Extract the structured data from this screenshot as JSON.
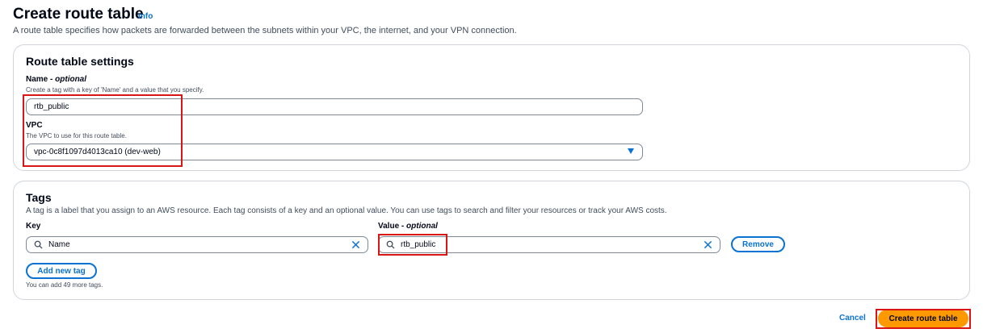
{
  "header": {
    "title": "Create route table",
    "info": "Info",
    "description": "A route table specifies how packets are forwarded between the subnets within your VPC, the internet, and your VPN connection."
  },
  "settings": {
    "title": "Route table settings",
    "name_label": "Name",
    "name_optional": "optional",
    "name_desc": "Create a tag with a key of 'Name' and a value that you specify.",
    "name_value": "rtb_public",
    "vpc_label": "VPC",
    "vpc_desc": "The VPC to use for this route table.",
    "vpc_value": "vpc-0c8f1097d4013ca10 (dev-web)"
  },
  "tags": {
    "title": "Tags",
    "description": "A tag is a label that you assign to an AWS resource. Each tag consists of a key and an optional value. You can use tags to search and filter your resources or track your AWS costs.",
    "key_label": "Key",
    "value_label": "Value",
    "value_optional": "optional",
    "key_value": "Name",
    "value_value": "rtb_public",
    "remove_label": "Remove",
    "add_label": "Add new tag",
    "hint": "You can add 49 more tags."
  },
  "footer": {
    "cancel_label": "Cancel",
    "create_label": "Create route table"
  },
  "colors": {
    "accent": "#0972d3",
    "primary": "#ff9900",
    "highlight": "#d91515"
  }
}
